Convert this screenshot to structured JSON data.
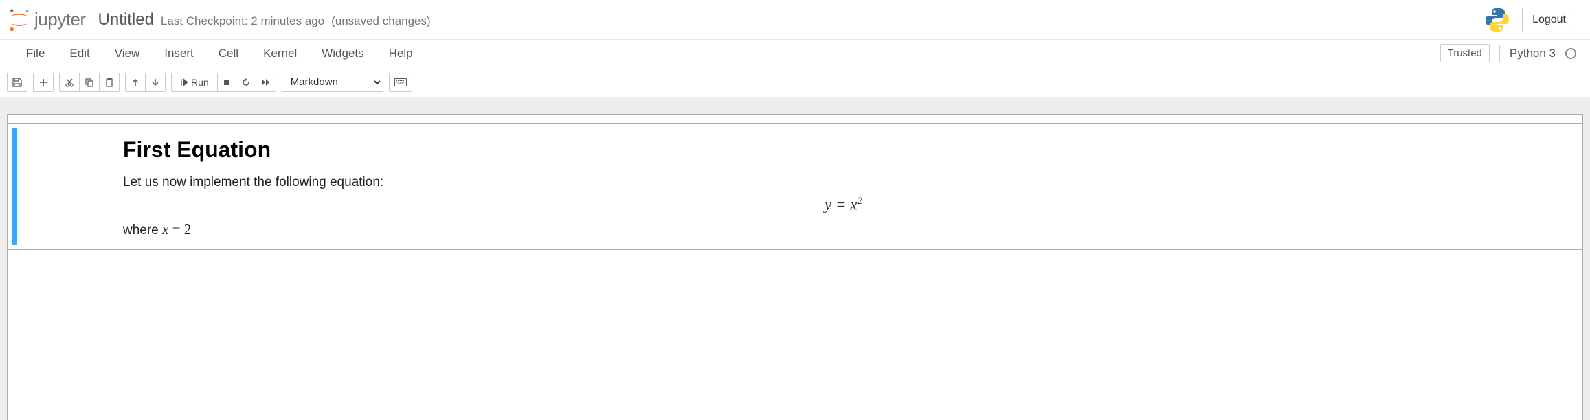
{
  "header": {
    "logo_text": "jupyter",
    "notebook_name": "Untitled",
    "checkpoint": "Last Checkpoint: 2 minutes ago",
    "unsaved": "(unsaved changes)",
    "logout_label": "Logout"
  },
  "menubar": {
    "items": [
      "File",
      "Edit",
      "View",
      "Insert",
      "Cell",
      "Kernel",
      "Widgets",
      "Help"
    ],
    "trusted_label": "Trusted",
    "kernel_name": "Python 3"
  },
  "toolbar": {
    "run_label": "Run",
    "cell_type": "Markdown"
  },
  "cell": {
    "heading": "First Equation",
    "intro": "Let us now implement the following equation:",
    "equation_lhs": "y",
    "equation_eq": " = ",
    "equation_rhs_base": "x",
    "equation_rhs_exp": "2",
    "where_prefix": "where ",
    "where_var": "x",
    "where_eq": " = ",
    "where_val": "2"
  }
}
